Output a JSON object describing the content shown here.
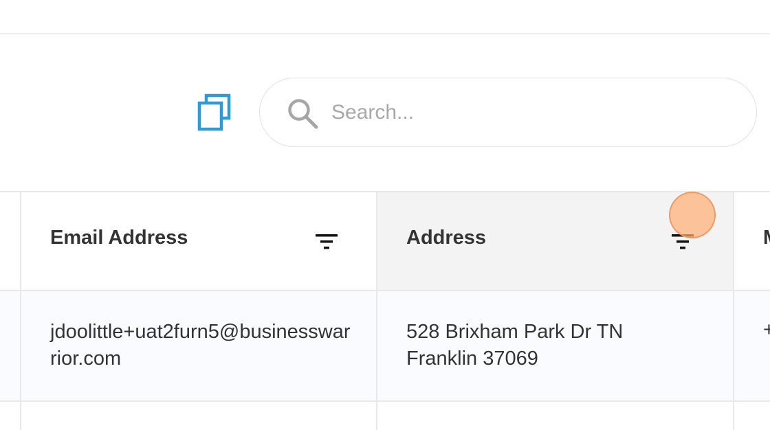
{
  "toolbar": {
    "copy_icon": "copy-icon",
    "accent_color": "#2e9bd6"
  },
  "search": {
    "placeholder": "Search...",
    "value": "",
    "icon": "search-icon"
  },
  "table": {
    "columns": [
      {
        "label": "Email Address",
        "icon": "filter-icon"
      },
      {
        "label": "Address",
        "icon": "filter-icon"
      },
      {
        "label": "M"
      }
    ],
    "rows": [
      {
        "email": "jdoolittle+uat2furn5@businesswarrior.com",
        "address": "528 Brixham Park Dr TN Franklin 37069",
        "next": "+"
      }
    ]
  }
}
